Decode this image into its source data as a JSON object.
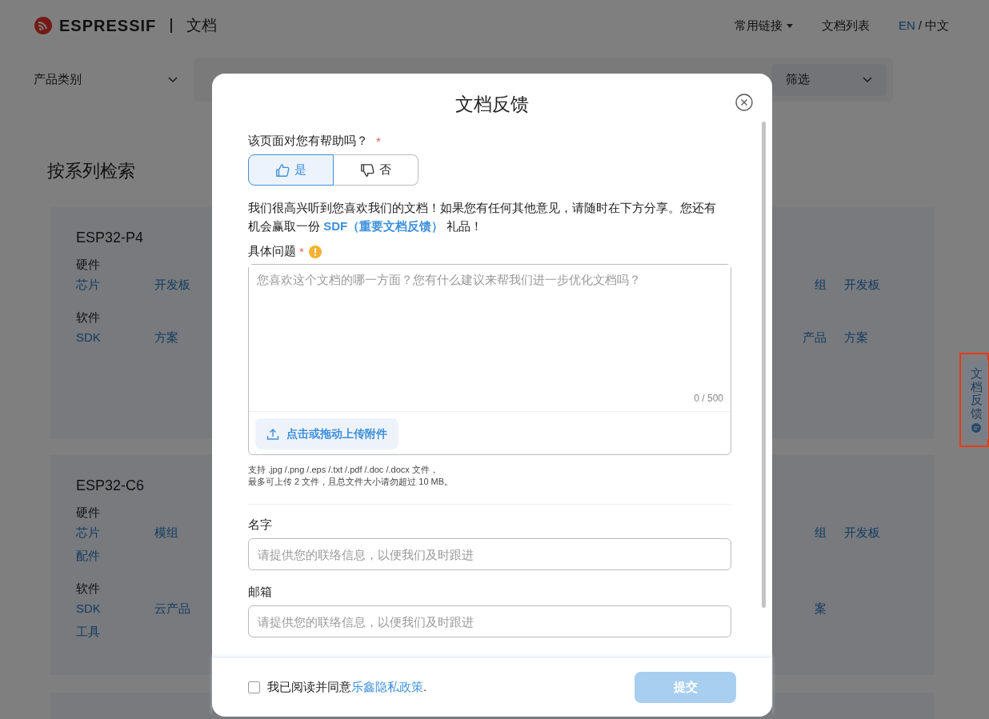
{
  "header": {
    "brand": "ESPRESSIF",
    "section": "文档",
    "nav": [
      {
        "label": "常用链接",
        "dropdown": true
      },
      {
        "label": "文档列表",
        "dropdown": false
      }
    ],
    "languages": [
      {
        "label": "EN",
        "selected": true
      },
      {
        "label": "中文",
        "selected": false
      }
    ],
    "language_separator": "/"
  },
  "filters": {
    "product_category": "产品类别",
    "filter_select": "筛选"
  },
  "series_heading": "按系列检索",
  "cards": [
    {
      "title": "ESP32-P4",
      "groups": [
        {
          "label": "硬件",
          "links_left": [
            "芯片",
            "开发板"
          ],
          "links_right": [
            "组",
            "开发板"
          ]
        },
        {
          "label": "软件",
          "links_left": [
            "SDK",
            "方案"
          ],
          "links_right": [
            "产品",
            "方案"
          ]
        }
      ]
    },
    {
      "title": "ESP32-C6",
      "groups": [
        {
          "label": "硬件",
          "links_left": [
            "芯片",
            "模组",
            "配件"
          ],
          "links_right": [
            "组",
            "开发板"
          ]
        },
        {
          "label": "软件",
          "links_left": [
            "SDK",
            "云产品",
            "工具"
          ],
          "links_right": [
            "案"
          ]
        }
      ]
    }
  ],
  "feedback_tab": {
    "label": "文档反馈",
    "highlighted": true
  },
  "dialog": {
    "title": "文档反馈",
    "question": {
      "label": "该页面对您有帮助吗？",
      "required_mark": "*",
      "choices": [
        {
          "label": "是",
          "kind": "thumbs-up",
          "selected": true
        },
        {
          "label": "否",
          "kind": "thumbs-down",
          "selected": false
        }
      ]
    },
    "message": {
      "text_before": "我们很高兴听到您喜欢我们的文档！如果您有任何其他意见，请随时在下方分享。您还有机会赢取一份 ",
      "link": "SDF（重要文档反馈）",
      "text_after": " 礼品！"
    },
    "details": {
      "label": "具体问题",
      "required_mark": "*",
      "warning": true,
      "placeholder": "您喜欢这个文档的哪一方面？您有什么建议来帮我们进一步优化文档吗？",
      "counter": "0 / 500",
      "upload_button": "点击或拖动上传附件",
      "hints": [
        "支持 .jpg /.png /.eps /.txt /.pdf /.doc /.docx 文件，",
        "最多可上传 2 文件，且总文件大小请勿超过 10 MB。"
      ]
    },
    "fields": [
      {
        "label": "名字",
        "placeholder": "请提供您的联络信息，以便我们及时跟进"
      },
      {
        "label": "邮箱",
        "placeholder": "请提供您的联络信息，以便我们及时跟进"
      }
    ],
    "consent": {
      "checked": false,
      "text": "我已阅读并同意",
      "link": "乐鑫隐私政策",
      "end": "."
    },
    "submit": {
      "label": "提交",
      "disabled": true
    }
  }
}
